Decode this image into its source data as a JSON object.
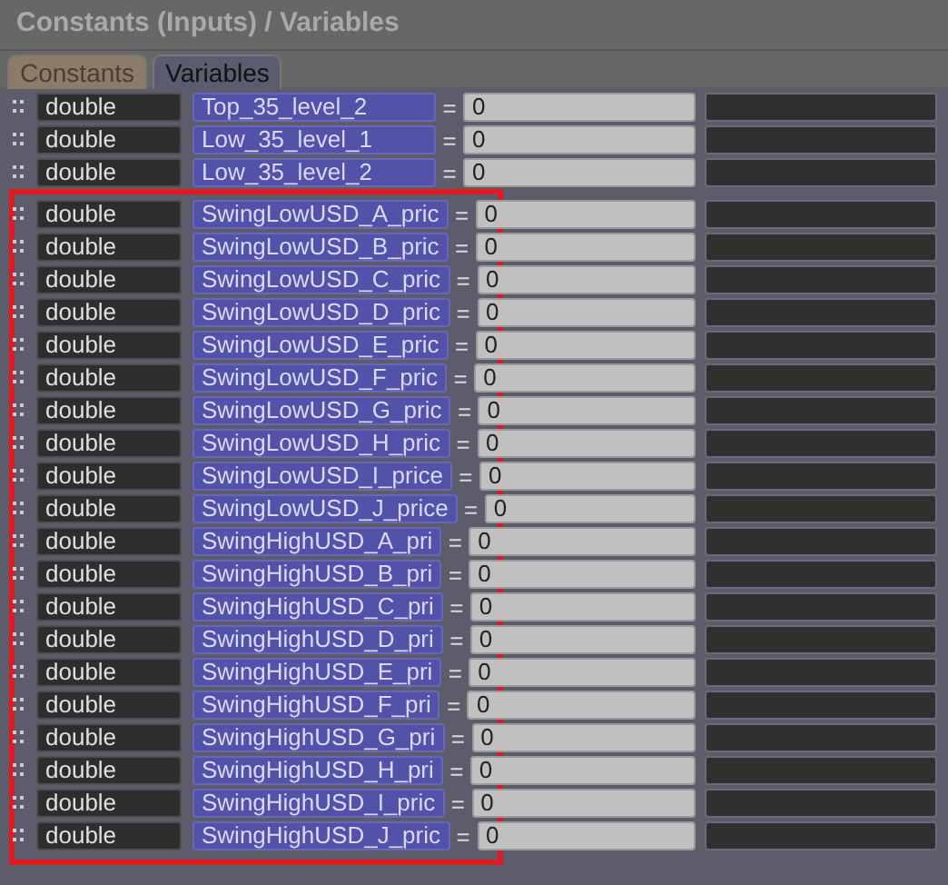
{
  "window": {
    "title": "Constants (Inputs) / Variables"
  },
  "tabs": [
    {
      "label": "Constants",
      "selected": false
    },
    {
      "label": "Variables",
      "selected": true
    }
  ],
  "rows": [
    {
      "type": "double",
      "name": "Top_35_level_2",
      "operator": "=",
      "value": "0"
    },
    {
      "type": "double",
      "name": "Low_35_level_1",
      "operator": "=",
      "value": "0"
    },
    {
      "type": "double",
      "name": "Low_35_level_2",
      "operator": "=",
      "value": "0"
    }
  ],
  "highlight": {
    "shown": true,
    "rows": [
      {
        "type": "double",
        "name": "SwingLowUSD_A_pric",
        "operator": "=",
        "value": "0"
      },
      {
        "type": "double",
        "name": "SwingLowUSD_B_pric",
        "operator": "=",
        "value": "0"
      },
      {
        "type": "double",
        "name": "SwingLowUSD_C_pric",
        "operator": "=",
        "value": "0"
      },
      {
        "type": "double",
        "name": "SwingLowUSD_D_pric",
        "operator": "=",
        "value": "0"
      },
      {
        "type": "double",
        "name": "SwingLowUSD_E_pric",
        "operator": "=",
        "value": "0"
      },
      {
        "type": "double",
        "name": "SwingLowUSD_F_pric",
        "operator": "=",
        "value": "0"
      },
      {
        "type": "double",
        "name": "SwingLowUSD_G_pric",
        "operator": "=",
        "value": "0"
      },
      {
        "type": "double",
        "name": "SwingLowUSD_H_pric",
        "operator": "=",
        "value": "0"
      },
      {
        "type": "double",
        "name": "SwingLowUSD_I_price",
        "operator": "=",
        "value": "0"
      },
      {
        "type": "double",
        "name": "SwingLowUSD_J_price",
        "operator": "=",
        "value": "0"
      },
      {
        "type": "double",
        "name": "SwingHighUSD_A_pri",
        "operator": "=",
        "value": "0"
      },
      {
        "type": "double",
        "name": "SwingHighUSD_B_pri",
        "operator": "=",
        "value": "0"
      },
      {
        "type": "double",
        "name": "SwingHighUSD_C_pri",
        "operator": "=",
        "value": "0"
      },
      {
        "type": "double",
        "name": "SwingHighUSD_D_pri",
        "operator": "=",
        "value": "0"
      },
      {
        "type": "double",
        "name": "SwingHighUSD_E_pri",
        "operator": "=",
        "value": "0"
      },
      {
        "type": "double",
        "name": "SwingHighUSD_F_pri",
        "operator": "=",
        "value": "0"
      },
      {
        "type": "double",
        "name": "SwingHighUSD_G_pri",
        "operator": "=",
        "value": "0"
      },
      {
        "type": "double",
        "name": "SwingHighUSD_H_pri",
        "operator": "=",
        "value": "0"
      },
      {
        "type": "double",
        "name": "SwingHighUSD_I_pric",
        "operator": "=",
        "value": "0"
      },
      {
        "type": "double",
        "name": "SwingHighUSD_J_pric",
        "operator": "=",
        "value": "0"
      }
    ]
  }
}
